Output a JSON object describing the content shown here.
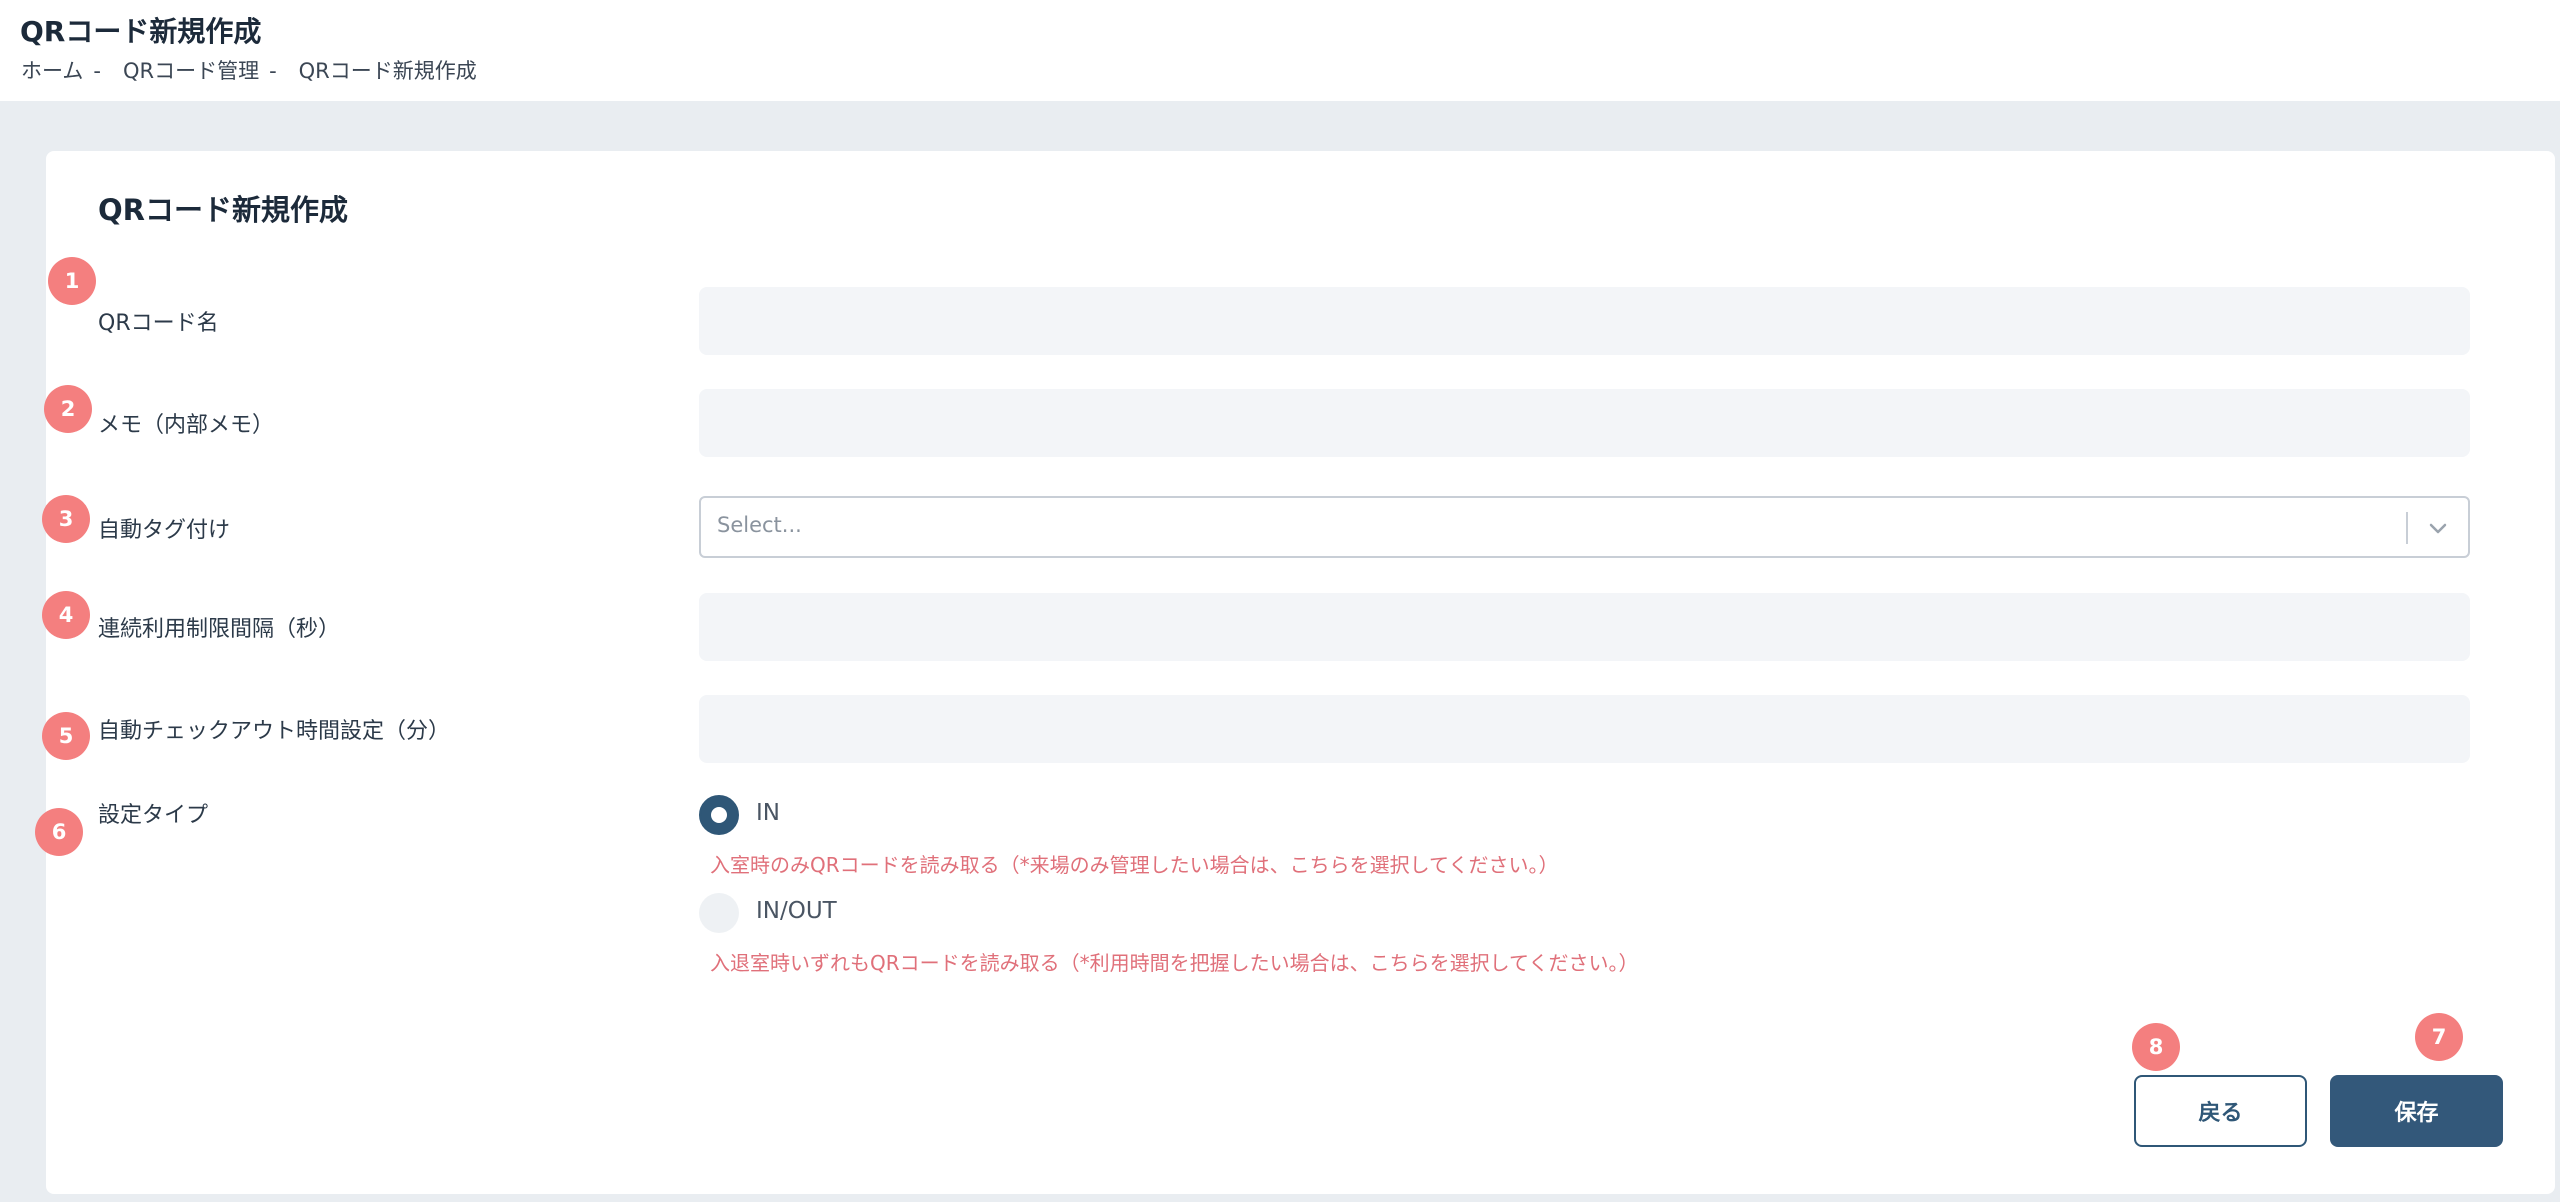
{
  "header": {
    "title": "QRコード新規作成",
    "breadcrumb": [
      "ホーム",
      "QRコード管理",
      "QRコード新規作成"
    ],
    "breadcrumb_separator": "-"
  },
  "form": {
    "title": "QRコード新規作成",
    "fields": {
      "qr_name": {
        "label": "QRコード名",
        "value": ""
      },
      "memo": {
        "label": "メモ（内部メモ）",
        "value": ""
      },
      "auto_tag": {
        "label": "自動タグ付け",
        "placeholder": "Select..."
      },
      "interval": {
        "label": "連続利用制限間隔（秒）",
        "value": ""
      },
      "auto_checkout": {
        "label": "自動チェックアウト時間設定（分）",
        "value": ""
      },
      "type": {
        "label": "設定タイプ",
        "options": [
          {
            "label": "IN",
            "selected": true,
            "hint": "入室時のみQRコードを読み取る（*来場のみ管理したい場合は、こちらを選択してください。）"
          },
          {
            "label": "IN/OUT",
            "selected": false,
            "hint": "入退室時いずれもQRコードを読み取る（*利用時間を把握したい場合は、こちらを選択してください。）"
          }
        ]
      }
    },
    "buttons": {
      "back": "戻る",
      "save": "保存"
    }
  },
  "badges": [
    "1",
    "2",
    "3",
    "4",
    "5",
    "6",
    "7",
    "8"
  ],
  "icons": {
    "select_arrow": "chevron-down-icon"
  },
  "colors": {
    "primary": "#33587a",
    "badge": "#f47f7f",
    "hint": "#e0707a",
    "input_bg": "#f3f5f8",
    "page_bg": "#e9edf1"
  }
}
